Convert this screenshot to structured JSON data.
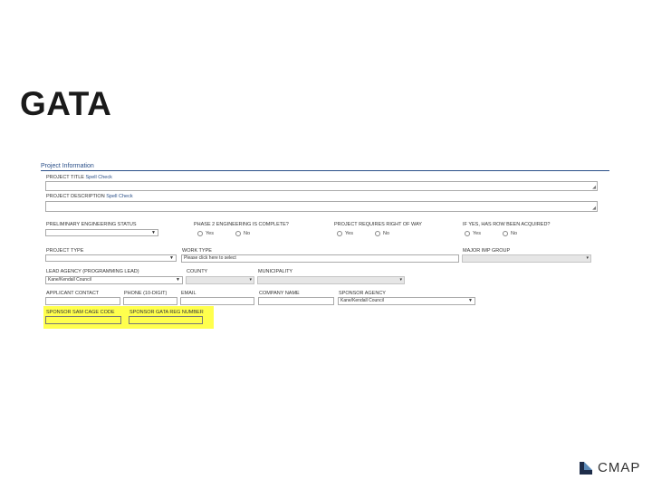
{
  "slide": {
    "title": "GATA"
  },
  "form": {
    "section_title": "Project Information",
    "project_title": {
      "label": "PROJECT TITLE",
      "spell": "Spell Check"
    },
    "project_description": {
      "label": "PROJECT DESCRIPTION",
      "spell": "Spell Check"
    },
    "preliminary_engineering_status": {
      "label": "PRELIMINARY ENGINEERING STATUS",
      "value": ""
    },
    "phase2_complete": {
      "label": "PHASE 2 ENGINEERING IS COMPLETE?",
      "yes": "Yes",
      "no": "No"
    },
    "requires_row": {
      "label": "PROJECT REQUIRES RIGHT OF WAY",
      "yes": "Yes",
      "no": "No"
    },
    "row_acquired": {
      "label": "IF YES, HAS ROW BEEN ACQUIRED?",
      "yes": "Yes",
      "no": "No"
    },
    "project_type": {
      "label": "PROJECT TYPE",
      "value": ""
    },
    "work_type": {
      "label": "WORK TYPE",
      "value": "Please click here to select"
    },
    "major_imp_group": {
      "label": "MAJOR IMP GROUP",
      "value": ""
    },
    "lead_agency": {
      "label": "LEAD AGENCY (Programming Lead)",
      "value": "Kane/Kendall Council"
    },
    "county": {
      "label": "COUNTY",
      "value": ""
    },
    "municipality": {
      "label": "MUNICIPALITY",
      "value": ""
    },
    "applicant_contact": {
      "label": "APPLICANT CONTACT"
    },
    "phone": {
      "label": "PHONE (10-DIGIT)"
    },
    "email": {
      "label": "EMAIL"
    },
    "company_name": {
      "label": "COMPANY NAME"
    },
    "sponsor_agency": {
      "label": "SPONSOR AGENCY",
      "value": "Kane/Kendall Council"
    },
    "sponsor_sam_cage_code": {
      "label": "SPONSOR SAM CAGE CODE"
    },
    "sponsor_gata_reg_number": {
      "label": "SPONSOR GATA REG NUMBER"
    }
  },
  "footer": {
    "logo_text": "CMAP"
  },
  "colors": {
    "highlight": "#ffff4d",
    "accent": "#2a4f88"
  }
}
